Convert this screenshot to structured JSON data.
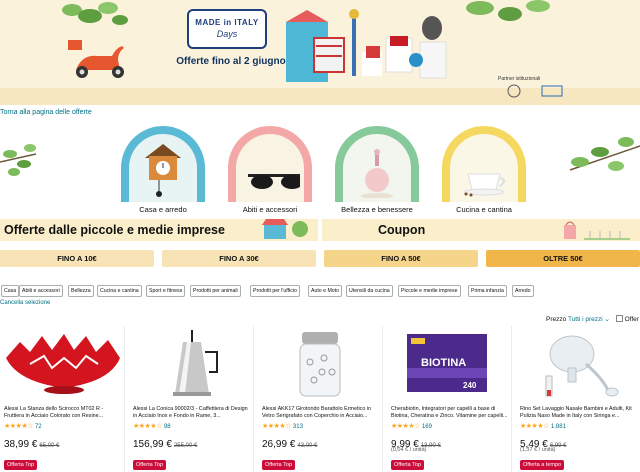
{
  "hero": {
    "badge_line1": "MADE in ITALY",
    "badge_line2": "Days",
    "subtitle": "Offerte fino al 2 giugno",
    "partners_label": "Partner istituzionali"
  },
  "back_link": "Torna alla pagina delle offerte",
  "categories": [
    {
      "label": "Casa e arredo",
      "icon": "cuckoo-clock-icon",
      "arch_color": "#5ab9d4",
      "inner_color": "#e8f4f4"
    },
    {
      "label": "Abiti e accessori",
      "icon": "sunglasses-icon",
      "arch_color": "#f3a7a7",
      "inner_color": "#f8f3e2"
    },
    {
      "label": "Bellezza e benessere",
      "icon": "perfume-icon",
      "arch_color": "#86c99a",
      "inner_color": "#f3f6ee"
    },
    {
      "label": "Cucina e cantina",
      "icon": "coffee-cup-icon",
      "arch_color": "#f5d860",
      "inner_color": "#fbf7e7"
    }
  ],
  "headlines": {
    "left": "Offerte dalle piccole e medie imprese",
    "right": "Coupon"
  },
  "price_bands": [
    {
      "label": "FINO A 10€",
      "color": "#f7e3b5"
    },
    {
      "label": "FINO A 30€",
      "color": "#f7e3b5"
    },
    {
      "label": "FINO A 50€",
      "color": "#f4d58a"
    },
    {
      "label": "OLTRE 50€",
      "color": "#f0b64a"
    }
  ],
  "filters": [
    "Casa",
    "Abiti e accessori",
    "Bellezza",
    "Cucina e cantina",
    "Sport e fitness",
    "Prodotti per animali",
    "Prodotti per l'ufficio",
    "Auto e Moto",
    "Utensili da cucina",
    "Piccole e medie imprese",
    "Prima infanzia",
    "Arredo"
  ],
  "clear_selection": "Cancella selezione",
  "price_filter": {
    "label": "Prezzo",
    "value": "Tutti i prezzi",
    "offer_label": "Offer"
  },
  "products": [
    {
      "title": "Alessi La Stanza dello Scirocco MT02 R - Fruttiera in Acciaio Colorato con Resine...",
      "stars": "★★★★☆",
      "count": "72",
      "price": "38,99 €",
      "was": "65,00 €",
      "unit": "",
      "badge": "Offerta Top"
    },
    {
      "title": "Alessi La Conica 90002/3 - Caffettiera di Design in Acciaio Inox e Fondo in Rame, 3...",
      "stars": "★★★★☆",
      "count": "98",
      "price": "156,99 €",
      "was": "255,00 €",
      "unit": "",
      "badge": "Offerta Top"
    },
    {
      "title": "Alessi AKK17 Girotondo Barattolo Ermetico in Vetro Serigrafato con Coperchio in Acciaio...",
      "stars": "★★★★☆",
      "count": "313",
      "price": "26,99 €",
      "was": "43,00 €",
      "unit": "",
      "badge": "Offerta Top"
    },
    {
      "title": "Cherabiotin, Integratori per capelli a base di Biotina, Cheratina e Zinco. Vitamine per capelli...",
      "stars": "★★★★☆",
      "count": "169",
      "price": "9,99 €",
      "was": "13,90 €",
      "unit": "(0,04 € / unità)",
      "badge": "Offerta Top"
    },
    {
      "title": "Rino Set Lavaggio Nasale Bambini e Adulti, Kit Pulizia Naso Made in Italy con Siringa e...",
      "stars": "★★★★☆",
      "count": "1.881",
      "price": "5,49 €",
      "was": "6,99 €",
      "unit": "(1,37 € / unità)",
      "badge": "Offerta a tempo"
    }
  ]
}
